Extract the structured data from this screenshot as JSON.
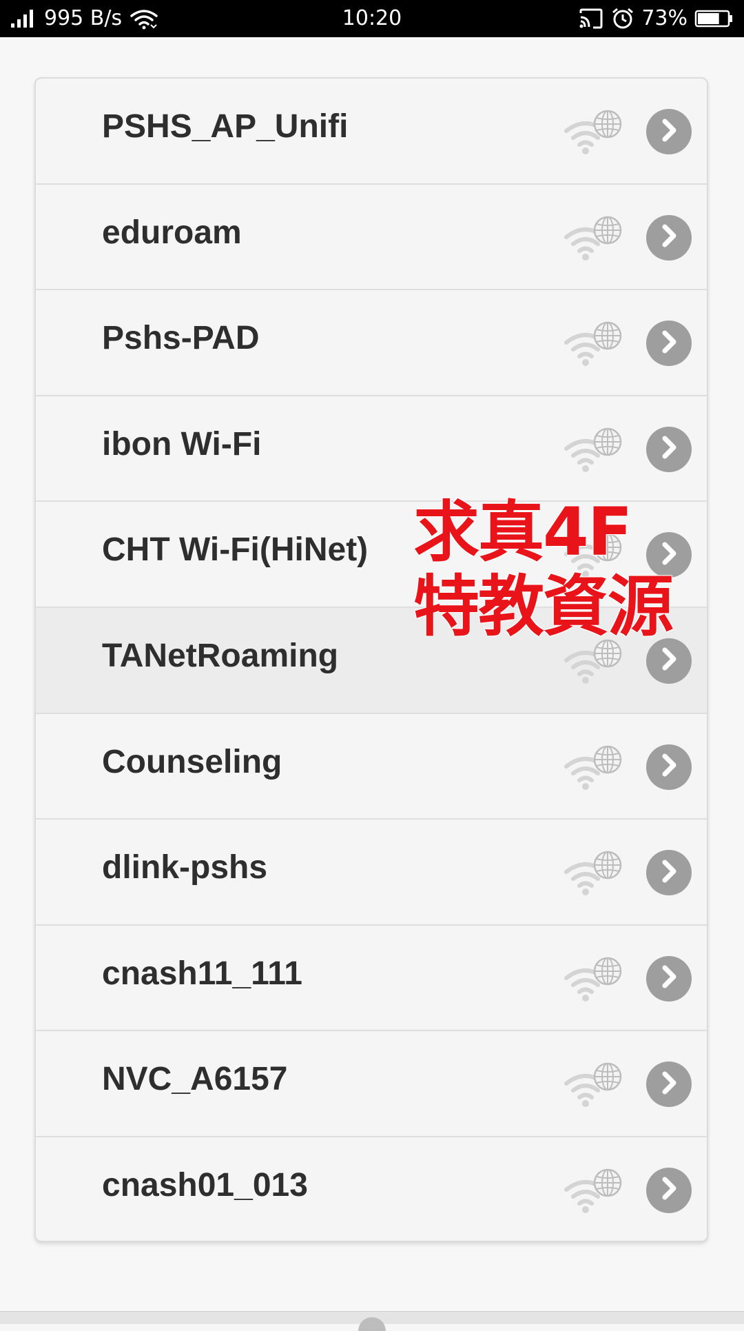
{
  "status_bar": {
    "network_speed": "995 B/s",
    "time": "10:20",
    "battery": "73%",
    "battery_level": 0.73,
    "icons": [
      "signal-icon",
      "wifi-icon",
      "cast-icon",
      "alarm-icon",
      "battery-icon"
    ]
  },
  "networks": [
    {
      "name": "PSHS_AP_Unifi",
      "highlighted": false
    },
    {
      "name": "eduroam",
      "highlighted": false
    },
    {
      "name": "Pshs-PAD",
      "highlighted": false
    },
    {
      "name": "ibon Wi-Fi",
      "highlighted": false
    },
    {
      "name": "CHT Wi-Fi(HiNet)",
      "highlighted": false
    },
    {
      "name": "TANetRoaming",
      "highlighted": true
    },
    {
      "name": "Counseling",
      "highlighted": false
    },
    {
      "name": "dlink-pshs",
      "highlighted": false
    },
    {
      "name": "cnash11_111",
      "highlighted": false
    },
    {
      "name": "NVC_A6157",
      "highlighted": false
    },
    {
      "name": "cnash01_013",
      "highlighted": false
    }
  ],
  "row_icons": {
    "status": "wifi-globe-icon",
    "action": "chevron-right-icon"
  },
  "overlay": {
    "line1": "求真4F",
    "line2": "特教資源"
  },
  "colors": {
    "status_bar_bg": "#000000",
    "overlay_text": "#e8141a",
    "arrow_button": "#9e9e9e",
    "highlight_row": "#ececec"
  }
}
